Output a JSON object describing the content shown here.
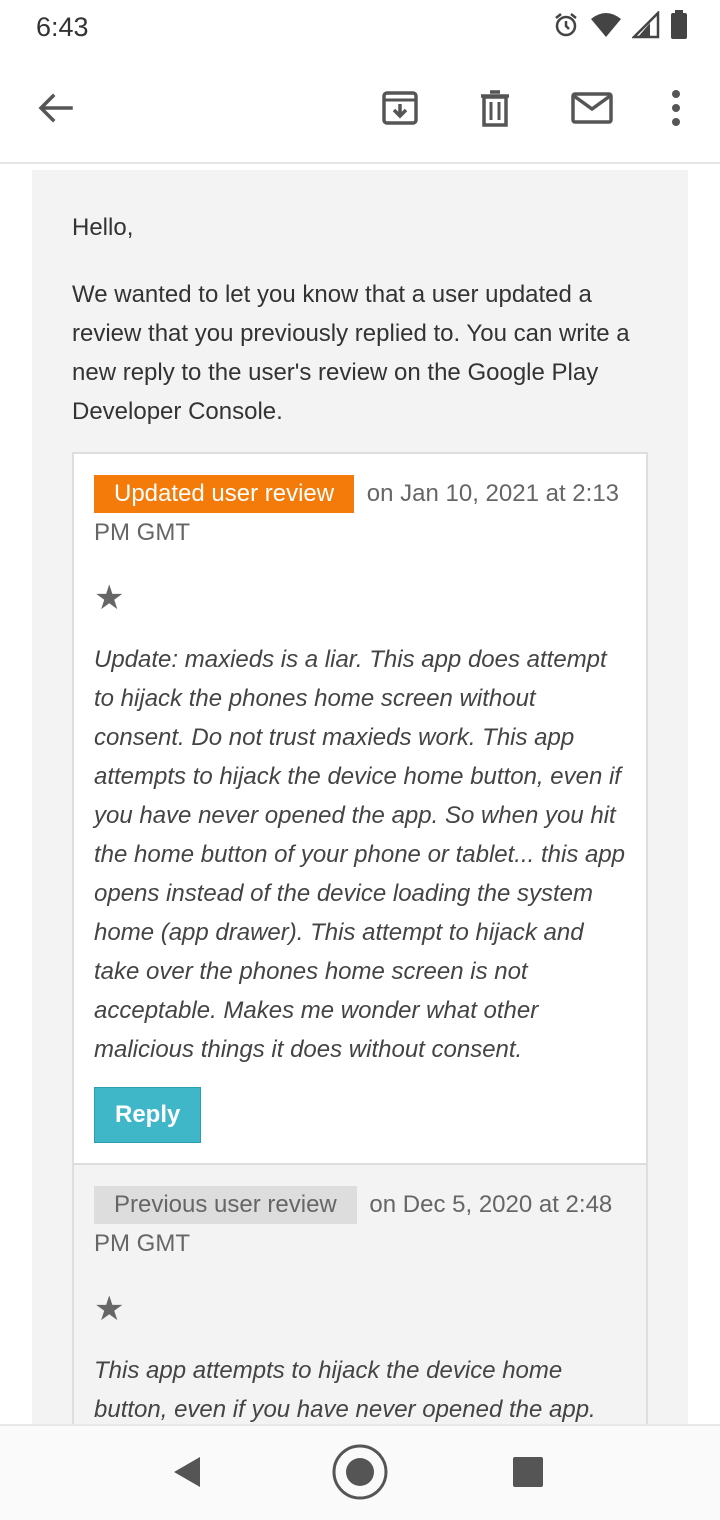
{
  "status_bar": {
    "time": "6:43",
    "icons": [
      "alarm-icon",
      "wifi-icon",
      "signal-icon",
      "battery-icon"
    ]
  },
  "toolbar": {
    "icons": [
      "back-arrow-icon",
      "archive-icon",
      "delete-icon",
      "mark-unread-icon",
      "more-vert-icon"
    ]
  },
  "email": {
    "greeting": "Hello,",
    "intro": "We wanted to let you know that a user updated a review that you previously replied to. You can write a new reply to the user's review on the Google Play Developer Console.",
    "updated_review": {
      "badge": "Updated user review",
      "date": "on Jan 10, 2021 at 2:13 PM GMT",
      "stars": "★",
      "text": "Update: maxieds is a liar. This app does attempt to hijack the phones home screen without consent. Do not trust maxieds work. This app attempts to hijack the device home button, even if you have never opened the app. So when you hit the home button of your phone or tablet... this app opens instead of the device loading the system home (app drawer). This attempt to hijack and take over the phones home screen is not acceptable. Makes me wonder what other malicious things it does without consent.",
      "reply_label": "Reply"
    },
    "previous_review": {
      "badge": "Previous user review",
      "date": "on Dec 5, 2020 at 2:48 PM GMT",
      "stars": "★",
      "text": "This app attempts to hijack the device home button, even if you have never opened the app."
    }
  },
  "colors": {
    "updated_badge": "#f47b0a",
    "reply_button": "#3fb7c9",
    "previous_badge": "#dddddd"
  },
  "nav_bar": {
    "icons": [
      "nav-back-icon",
      "nav-home-icon",
      "nav-recents-icon"
    ]
  }
}
